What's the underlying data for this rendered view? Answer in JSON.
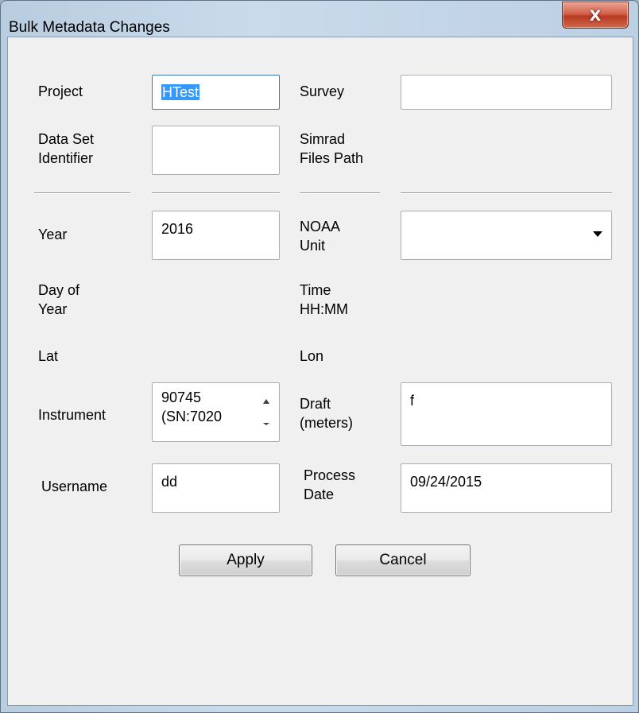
{
  "window": {
    "title": "Bulk Metadata Changes",
    "close_glyph": "X"
  },
  "fields": {
    "project": {
      "label": "Project",
      "value": "HTest"
    },
    "survey": {
      "label": "Survey",
      "value": ""
    },
    "data_set_identifier": {
      "label": "Data Set\nIdentifier",
      "value": ""
    },
    "simrad_files_path": {
      "label": "Simrad\nFiles Path"
    },
    "year": {
      "label": "Year",
      "value": "2016"
    },
    "noaa_unit": {
      "label": "NOAA\nUnit",
      "selected": ""
    },
    "day_of_year": {
      "label": "Day of\nYear"
    },
    "time": {
      "label": "Time\nHH:MM"
    },
    "lat": {
      "label": "Lat"
    },
    "lon": {
      "label": "Lon"
    },
    "instrument": {
      "label": "Instrument",
      "value": "90745\n(SN:7020"
    },
    "draft": {
      "label": "Draft\n(meters)",
      "value": "f"
    },
    "username": {
      "label": "Username",
      "value": "dd"
    },
    "process_date": {
      "label": "Process\nDate",
      "value": "09/24/2015"
    }
  },
  "buttons": {
    "apply": "Apply",
    "cancel": "Cancel"
  }
}
